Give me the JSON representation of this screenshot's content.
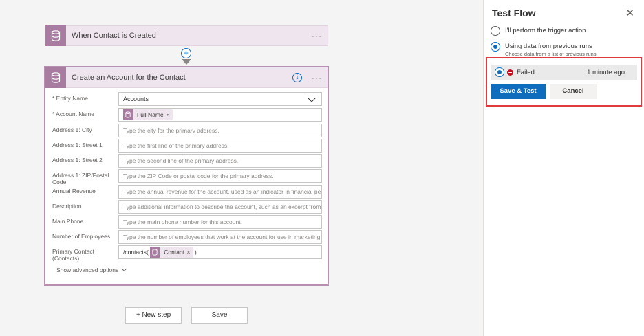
{
  "trigger": {
    "title": "When Contact is Created",
    "menu": "···",
    "icon": "database-icon"
  },
  "connector": {
    "plus": "+"
  },
  "action": {
    "title": "Create an Account for the Contact",
    "info": "i",
    "menu": "···",
    "fields": [
      {
        "label": "* Entity Name",
        "value": "Accounts"
      },
      {
        "label": "* Account Name",
        "token": "Full Name",
        "token_remove": "×"
      },
      {
        "label": "Address 1: City",
        "placeholder": "Type the city for the primary address."
      },
      {
        "label": "Address 1: Street 1",
        "placeholder": "Type the first line of the primary address."
      },
      {
        "label": "Address 1: Street 2",
        "placeholder": "Type the second line of the primary address."
      },
      {
        "label": "Address 1: ZIP/Postal Code",
        "placeholder": "Type the ZIP Code or postal code for the primary address."
      },
      {
        "label": "Annual Revenue",
        "placeholder": "Type the annual revenue for the account, used as an indicator in financial perf"
      },
      {
        "label": "Description",
        "placeholder": "Type additional information to describe the account, such as an excerpt from"
      },
      {
        "label": "Main Phone",
        "placeholder": "Type the main phone number for this account."
      },
      {
        "label": "Number of Employees",
        "placeholder": "Type the number of employees that work at the account for use in marketing"
      },
      {
        "label": "Primary Contact (Contacts)",
        "prefix": "/contacts(",
        "token": "Contact",
        "token_remove": "×",
        "suffix": ")"
      }
    ],
    "advanced": "Show advanced options"
  },
  "bottom": {
    "new_step": "+ New step",
    "save": "Save"
  },
  "panel": {
    "title": "Test Flow",
    "close": "✕",
    "option1": "I'll perform the trigger action",
    "option2": "Using data from previous runs",
    "option2_sub": "Choose data from a list of previous runs:",
    "run": {
      "status": "Failed",
      "time": "1 minute ago"
    },
    "save_test": "Save & Test",
    "cancel": "Cancel"
  },
  "colors": {
    "accent": "#0f6cbd",
    "entity": "#a87ca0",
    "highlight": "#e0393e",
    "failed": "#c50f1f"
  }
}
